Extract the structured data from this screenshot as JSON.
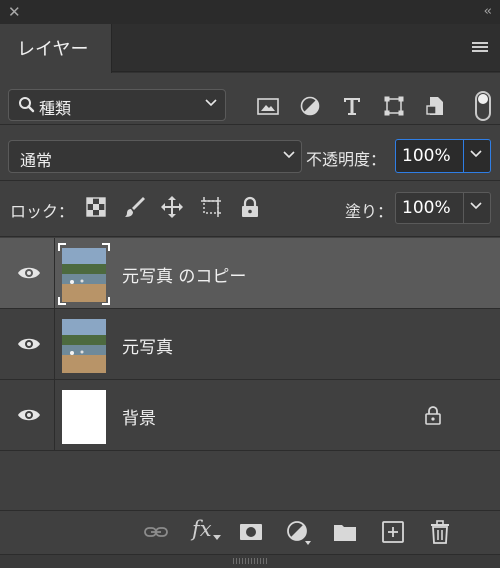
{
  "window": {
    "close_glyph": "✕",
    "collapse_glyph": "‹‹"
  },
  "tabs": [
    {
      "label": "レイヤー"
    }
  ],
  "filter": {
    "label": "種類",
    "icons": [
      "image-filter-icon",
      "adjustment-filter-icon",
      "type-filter-icon",
      "shape-filter-icon",
      "smart-object-filter-icon"
    ]
  },
  "blend": {
    "mode": "通常",
    "opacity_label": "不透明度：",
    "opacity": "100%"
  },
  "lock": {
    "label": "ロック：",
    "fill_label": "塗り：",
    "fill": "100%"
  },
  "layers": [
    {
      "name": "元写真 のコピー",
      "selected": true,
      "visible": true,
      "thumbnail": "photo"
    },
    {
      "name": "元写真",
      "selected": false,
      "visible": true,
      "thumbnail": "photo"
    },
    {
      "name": "背景",
      "selected": false,
      "visible": true,
      "thumbnail": "white",
      "locked": true
    }
  ],
  "bottom_bar": {
    "fx_label": "fx"
  },
  "colors": {
    "panel": "#404040",
    "selected_layer": "#5a5a5a",
    "focus": "#2f7ee5"
  }
}
